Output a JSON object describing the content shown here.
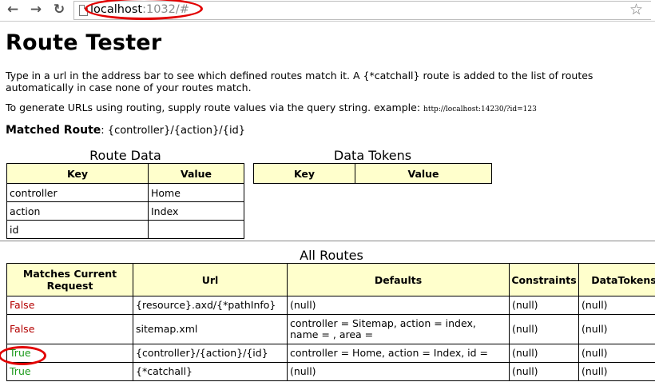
{
  "browser": {
    "url_host": "localhost",
    "url_rest": ":1032/#",
    "back_icon": "←",
    "forward_icon": "→",
    "reload_icon": "↻",
    "star_icon": "☆"
  },
  "page": {
    "title": "Route Tester",
    "intro": "Type in a url in the address bar to see which defined routes match it. A {*catchall} route is added to the list of routes automatically in case none of your routes match.",
    "generate_text": "To generate URLs using routing, supply route values via the query string. example:",
    "generate_example": "http://localhost:14230/?id=123",
    "matched_label": "Matched Route",
    "matched_value": ": {controller}/{action}/{id}"
  },
  "route_data": {
    "caption": "Route Data",
    "headers": [
      "Key",
      "Value"
    ],
    "rows": [
      [
        "controller",
        "Home"
      ],
      [
        "action",
        "Index"
      ],
      [
        "id",
        ""
      ]
    ]
  },
  "data_tokens": {
    "caption": "Data Tokens",
    "headers": [
      "Key",
      "Value"
    ]
  },
  "all_routes": {
    "caption": "All Routes",
    "headers": [
      "Matches Current Request",
      "Url",
      "Defaults",
      "Constraints",
      "DataTokens"
    ],
    "rows": [
      [
        "False",
        "{resource}.axd/{*pathInfo}",
        "(null)",
        "(null)",
        "(null)"
      ],
      [
        "False",
        "sitemap.xml",
        "controller = Sitemap, action = index, name = , area =",
        "(null)",
        "(null)"
      ],
      [
        "True",
        "{controller}/{action}/{id}",
        "controller = Home, action = Index, id =",
        "(null)",
        "(null)"
      ],
      [
        "True",
        "{*catchall}",
        "(null)",
        "(null)",
        "(null)"
      ]
    ]
  },
  "colors": {
    "header_bg": "#ffffcc",
    "false_text": "#b40000",
    "true_text": "#1a9a1a",
    "annotation": "#e20000"
  }
}
